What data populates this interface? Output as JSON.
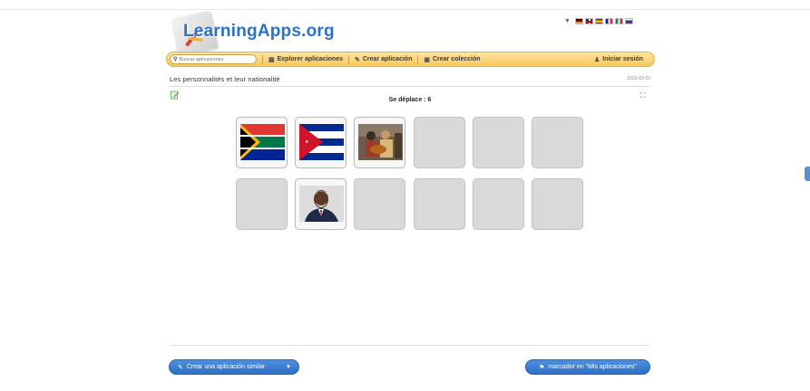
{
  "header": {
    "logo_text": "LearningApps.org",
    "languages": [
      "de",
      "en",
      "es",
      "fr",
      "it",
      "ru"
    ]
  },
  "nav": {
    "search_placeholder": "Buscar aplicaciones",
    "explore_label": "Explorer aplicaciones",
    "create_app_label": "Crear aplicación",
    "create_collection_label": "Crear colección",
    "login_label": "Iniciar sesión"
  },
  "app": {
    "title": "Les personnalités et leur nationalité",
    "date": "2022-03-22",
    "moves_text": "Se déplace : 6"
  },
  "cards": [
    {
      "state": "revealed",
      "content": "flag-south-africa"
    },
    {
      "state": "revealed",
      "content": "flag-cuba"
    },
    {
      "state": "revealed",
      "content": "photo-musicians"
    },
    {
      "state": "hidden"
    },
    {
      "state": "hidden"
    },
    {
      "state": "hidden"
    },
    {
      "state": "hidden"
    },
    {
      "state": "revealed",
      "content": "photo-portrait"
    },
    {
      "state": "hidden"
    },
    {
      "state": "hidden"
    },
    {
      "state": "hidden"
    },
    {
      "state": "hidden"
    }
  ],
  "footer": {
    "similar_label": "Crear una aplicación similar",
    "bookmark_label": "marcador en \"Mis aplicaciones\""
  },
  "colors": {
    "accent": "#2f6fc4",
    "navbar": "#f7c95b",
    "card_hidden": "#d9d9db"
  }
}
